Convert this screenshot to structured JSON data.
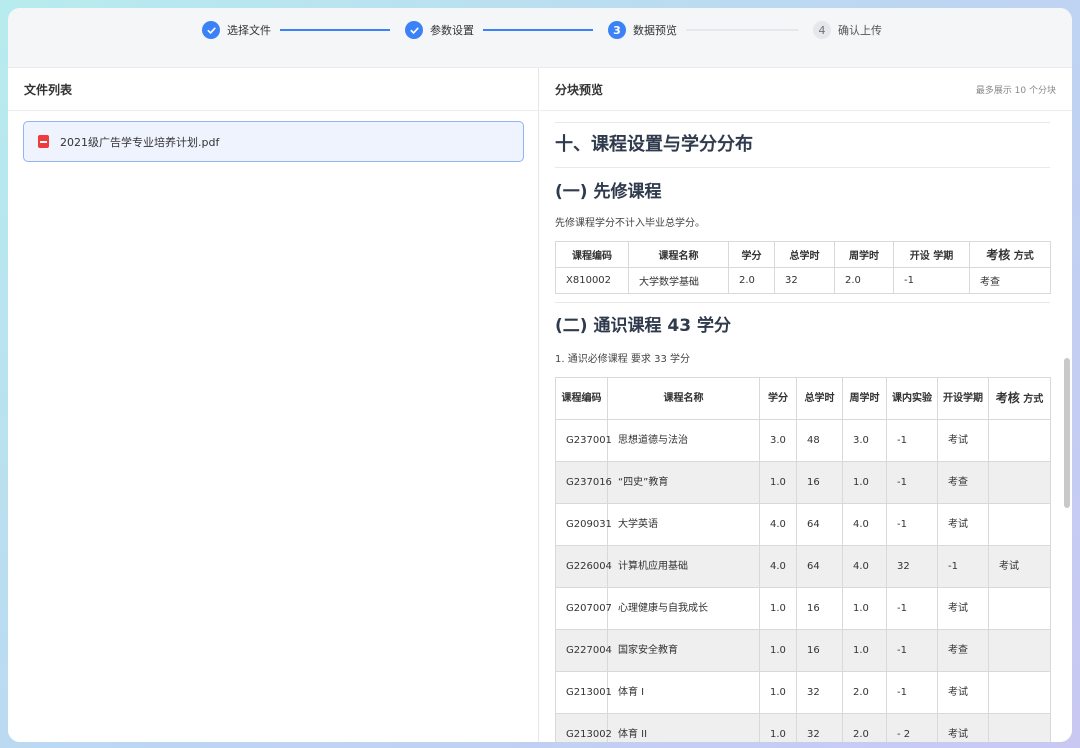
{
  "steps": [
    {
      "label": "选择文件",
      "status": "done"
    },
    {
      "label": "参数设置",
      "status": "done"
    },
    {
      "label": "数据预览",
      "status": "active",
      "number": "3"
    },
    {
      "label": "确认上传",
      "status": "pending",
      "number": "4"
    }
  ],
  "left_panel": {
    "title": "文件列表",
    "files": [
      {
        "name": "2021级广告学专业培养计划.pdf",
        "icon": "pdf-file-icon"
      }
    ]
  },
  "right_panel": {
    "title": "分块预览",
    "note": "最多展示 10 个分块",
    "heading1": "十、课程设置与学分分布",
    "section1": {
      "heading": "(一) 先修课程",
      "text": "先修课程学分不计入毕业总学分。",
      "headers": [
        "课程编码",
        "课程名称",
        "学分",
        "总学时",
        "周学时",
        "开设 学期",
        "考核",
        "方式"
      ],
      "row": [
        "X810002",
        "大学数学基础",
        "2.0",
        "32",
        "2.0",
        "-1",
        "考查"
      ]
    },
    "section2": {
      "heading": "(二) 通识课程 43 学分",
      "text": "1. 通识必修课程 要求 33 学分",
      "headers": [
        "课程编码",
        "课程名称",
        "学分",
        "总学时",
        "周学时",
        "课内实验",
        "开设学期",
        "考核",
        "方式"
      ],
      "rows": [
        [
          "G237001",
          "思想道德与法治",
          "3.0",
          "48",
          "3.0",
          "-1",
          "考试",
          ""
        ],
        [
          "G237016",
          "“四史”教育",
          "1.0",
          "16",
          "1.0",
          "-1",
          "考查",
          ""
        ],
        [
          "G209031",
          "大学英语",
          "4.0",
          "64",
          "4.0",
          "-1",
          "考试",
          ""
        ],
        [
          "G226004",
          "计算机应用基础",
          "4.0",
          "64",
          "4.0",
          "32",
          "-1",
          "考试"
        ],
        [
          "G207007",
          "心理健康与自我成长",
          "1.0",
          "16",
          "1.0",
          "-1",
          "考试",
          ""
        ],
        [
          "G227004",
          "国家安全教育",
          "1.0",
          "16",
          "1.0",
          "-1",
          "考查",
          ""
        ],
        [
          "G213001",
          "体育 I",
          "1.0",
          "32",
          "2.0",
          "-1",
          "考试",
          ""
        ],
        [
          "G213002",
          "体育 II",
          "1.0",
          "32",
          "2.0",
          "- 2",
          "考试",
          ""
        ]
      ]
    }
  },
  "colors": {
    "accent": "#3b82f6",
    "row_alt": "#efefef"
  }
}
